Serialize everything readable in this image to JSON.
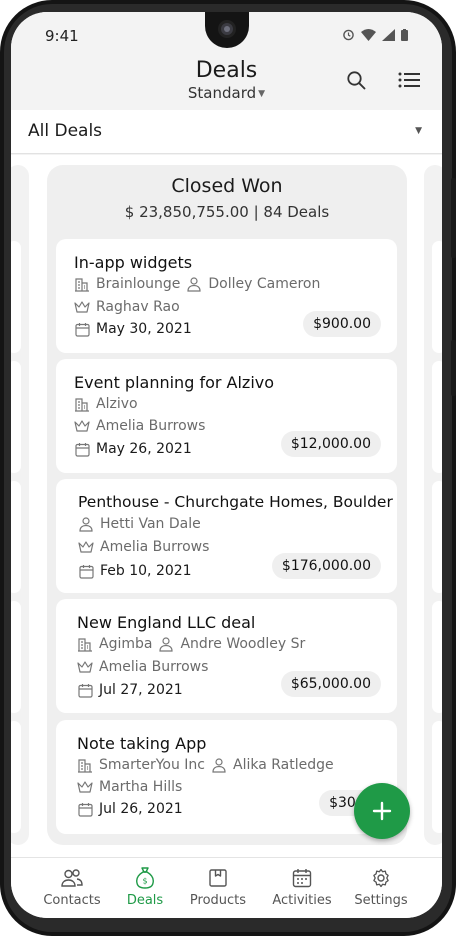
{
  "status_bar": {
    "time": "9:41"
  },
  "header": {
    "title": "Deals",
    "subtitle": "Standard"
  },
  "filter": {
    "label": "All Deals"
  },
  "column": {
    "title": "Closed Won",
    "summary": "$ 23,850,755.00 | 84 Deals"
  },
  "deals": [
    {
      "title": "In-app widgets",
      "account": "Brainlounge",
      "contact": "Dolley Cameron",
      "owner": "Raghav Rao",
      "date": "May 30, 2021",
      "amount": "$900.00"
    },
    {
      "title": "Event planning for Alzivo",
      "account": "Alzivo",
      "contact": "",
      "owner": "Amelia Burrows",
      "date": "May 26, 2021",
      "amount": "$12,000.00"
    },
    {
      "title": "Penthouse - Churchgate Homes, Boulder",
      "account": "",
      "contact": "Hetti Van Dale",
      "owner": "Amelia Burrows",
      "date": "Feb 10, 2021",
      "amount": "$176,000.00"
    },
    {
      "title": "New England LLC deal",
      "account": "Agimba",
      "contact": "Andre Woodley Sr",
      "owner": "Amelia Burrows",
      "date": "Jul 27, 2021",
      "amount": "$65,000.00"
    },
    {
      "title": "Note taking App",
      "account": "SmarterYou Inc",
      "contact": "Alika Ratledge",
      "owner": "Martha Hills",
      "date": "Jul 26, 2021",
      "amount": "$30,000"
    }
  ],
  "nav": {
    "contacts": "Contacts",
    "deals": "Deals",
    "products": "Products",
    "activities": "Activities",
    "settings": "Settings"
  },
  "colors": {
    "accent": "#1f9a47",
    "background": "#f3f3f3"
  }
}
